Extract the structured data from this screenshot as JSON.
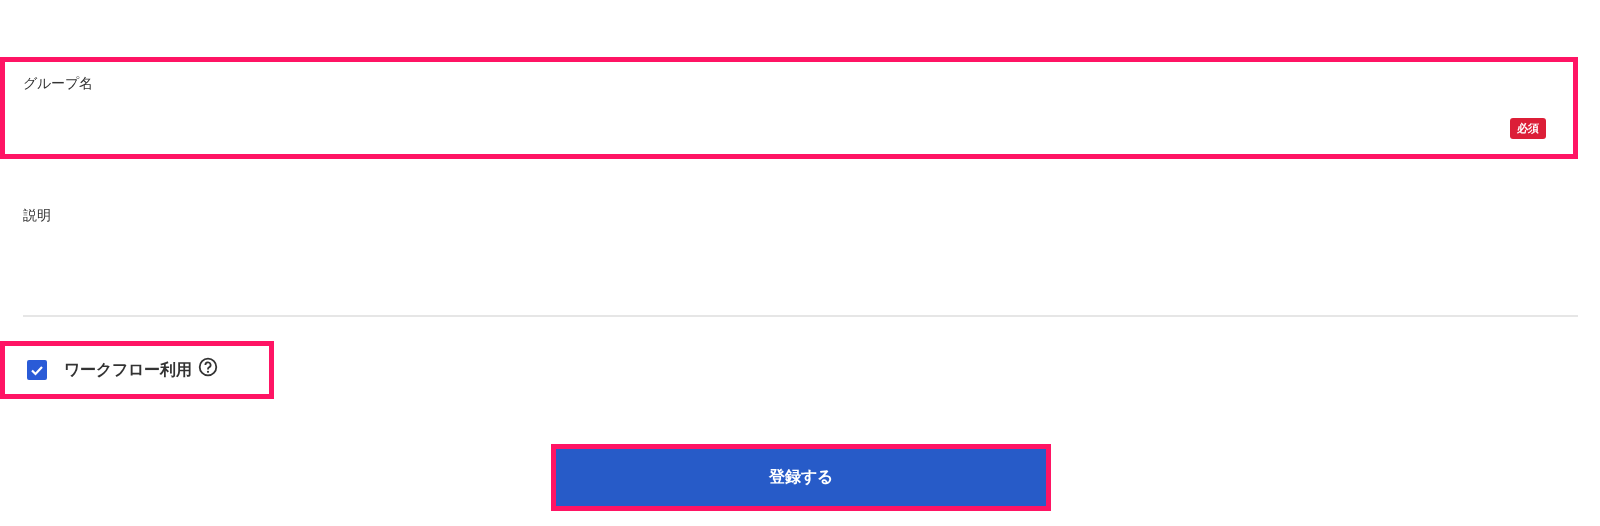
{
  "fields": [
    {
      "label": "グループ名",
      "badge": "必須",
      "highlighted": true
    },
    {
      "label": "説明",
      "highlighted": false
    }
  ],
  "workflow": {
    "label": "ワークフロー利用",
    "checked": true,
    "help_icon": true,
    "highlighted": true
  },
  "submit": {
    "label": "登録する",
    "highlighted": true
  }
}
